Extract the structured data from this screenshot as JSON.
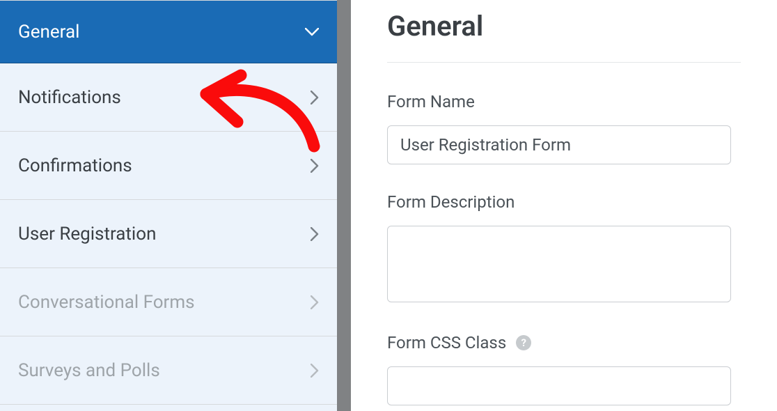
{
  "sidebar": {
    "items": [
      {
        "label": "General",
        "active": true,
        "disabled": false
      },
      {
        "label": "Notifications",
        "active": false,
        "disabled": false
      },
      {
        "label": "Confirmations",
        "active": false,
        "disabled": false
      },
      {
        "label": "User Registration",
        "active": false,
        "disabled": false
      },
      {
        "label": "Conversational Forms",
        "active": false,
        "disabled": true
      },
      {
        "label": "Surveys and Polls",
        "active": false,
        "disabled": true
      }
    ]
  },
  "main": {
    "title": "General",
    "form_name": {
      "label": "Form Name",
      "value": "User Registration Form"
    },
    "form_description": {
      "label": "Form Description",
      "value": ""
    },
    "form_css_class": {
      "label": "Form CSS Class",
      "value": ""
    }
  }
}
